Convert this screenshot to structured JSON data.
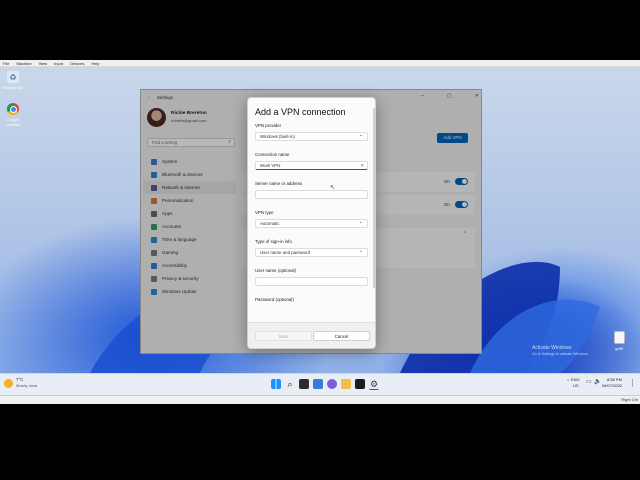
{
  "vm_menu": [
    "File",
    "Machine",
    "View",
    "Input",
    "Devices",
    "Help"
  ],
  "desktop_icons": [
    {
      "label": "Recycle Bin",
      "icon": "recycle-bin-icon"
    },
    {
      "label": "Google Chrome",
      "icon": "chrome-icon"
    }
  ],
  "desktop_file": {
    "label": "gdiff",
    "icon": "file-icon"
  },
  "watermark": {
    "line1": "Activate Windows",
    "line2": "Go to Settings to activate Windows."
  },
  "settings": {
    "title": "Settings",
    "user_name": "Richie Brereton",
    "user_email": "richiebr@gmail.com",
    "search_placeholder": "Find a setting",
    "nav": [
      {
        "label": "System",
        "icon": "system-icon",
        "color": "#3b7fd4"
      },
      {
        "label": "Bluetooth & devices",
        "icon": "bluetooth-icon",
        "color": "#2b88d8"
      },
      {
        "label": "Network & internet",
        "icon": "network-icon",
        "color": "#5a5a9a"
      },
      {
        "label": "Personalization",
        "icon": "brush-icon",
        "color": "#d4793b"
      },
      {
        "label": "Apps",
        "icon": "apps-icon",
        "color": "#6b6b6b"
      },
      {
        "label": "Accounts",
        "icon": "accounts-icon",
        "color": "#2fa36b"
      },
      {
        "label": "Time & language",
        "icon": "clock-icon",
        "color": "#2b88d8"
      },
      {
        "label": "Gaming",
        "icon": "gaming-icon",
        "color": "#7a7a7a"
      },
      {
        "label": "Accessibility",
        "icon": "accessibility-icon",
        "color": "#3b7fd4"
      },
      {
        "label": "Privacy & security",
        "icon": "shield-icon",
        "color": "#7a7a7a"
      },
      {
        "label": "Windows Update",
        "icon": "update-icon",
        "color": "#2b88d8"
      }
    ],
    "add_vpn_button": "Add VPN",
    "toggle1_label": "On",
    "toggle2_label": "On"
  },
  "dialog": {
    "title": "Add a VPN connection",
    "vpn_provider_label": "VPN provider",
    "vpn_provider_value": "Windows (built-in)",
    "connection_name_label": "Connection name",
    "connection_name_value": "Work VPN",
    "server_label": "Server name or address",
    "server_value": "",
    "vpn_type_label": "VPN type",
    "vpn_type_value": "Automatic",
    "signin_label": "Type of sign-in info",
    "signin_value": "User name and password",
    "username_label": "User name (optional)",
    "username_value": "",
    "password_label": "Password (optional)",
    "save_label": "Save",
    "cancel_label": "Cancel"
  },
  "taskbar": {
    "weather_temp": "7°C",
    "weather_desc": "Mostly clear",
    "lang_top": "ENG",
    "lang_bottom": "US",
    "time": "8:58 PM",
    "date": "06/07/2022",
    "status_right": "Right Ctrl"
  }
}
